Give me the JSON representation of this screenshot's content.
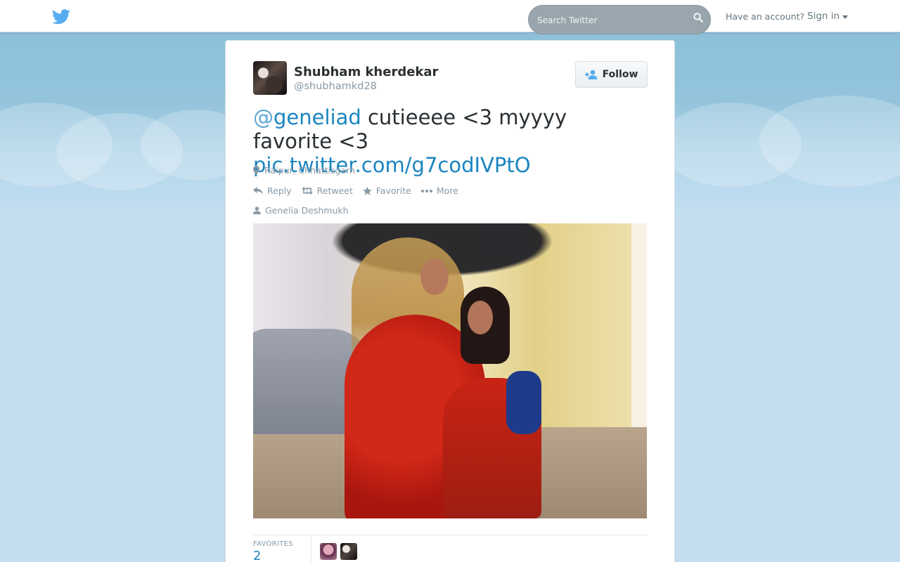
{
  "header": {
    "search_placeholder": "Search Twitter",
    "account_prompt": "Have an account?",
    "signin_label": "Sign in"
  },
  "tweet": {
    "author": {
      "full_name": "Shubham kherdekar",
      "username": "@shubhamkd28"
    },
    "follow_label": "Follow",
    "text": {
      "mention_at": "@",
      "mention_name": "geneliad",
      "body": " cutieeee <3 myyyy favorite <3 ",
      "link": "pic.twitter.com/g7codIVPtO"
    },
    "location": "Raipur, Chhattisgarh",
    "actions": {
      "reply": "Reply",
      "retweet": "Retweet",
      "favorite": "Favorite",
      "more": "More"
    },
    "tagged_person": "Genelia Deshmukh",
    "stats": {
      "favorites_label": "FAVORITES",
      "favorites_count": "2"
    }
  },
  "colors": {
    "link": "#1a85bf",
    "muted": "#8899a6",
    "brand": "#55acee"
  }
}
